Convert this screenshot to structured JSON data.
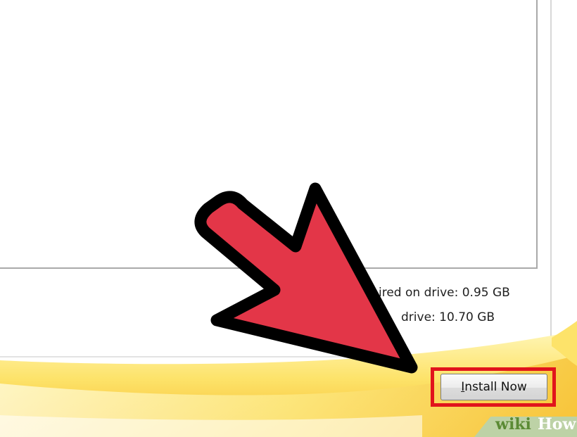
{
  "disk_space": {
    "required": "ired on drive: 0.95 GB",
    "available": "drive: 10.70 GB"
  },
  "actions": {
    "install_accel": "I",
    "install_rest": "nstall Now"
  },
  "annotation": {
    "arrow_color": "#e33648",
    "highlight_color": "#e1141c"
  },
  "watermark": {
    "part1": "wiki",
    "part2": "How"
  }
}
